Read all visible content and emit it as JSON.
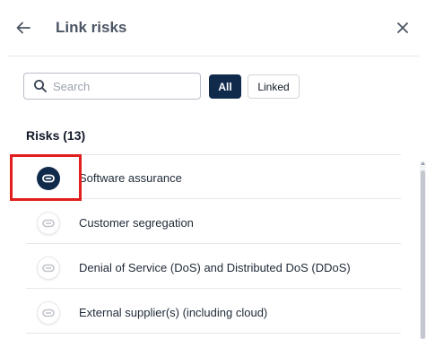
{
  "header": {
    "title": "Link risks",
    "back_icon": "arrow-left-icon",
    "close_icon": "close-icon"
  },
  "search": {
    "placeholder": "Search",
    "value": ""
  },
  "filters": {
    "all_label": "All",
    "linked_label": "Linked",
    "active": "All"
  },
  "section": {
    "heading": "Risks (13)"
  },
  "risks": [
    {
      "label": "Software assurance",
      "linked": true
    },
    {
      "label": "Customer segregation",
      "linked": false
    },
    {
      "label": "Denial of Service (DoS) and Distributed DoS (DDoS)",
      "linked": false
    },
    {
      "label": "External supplier(s) (including cloud)",
      "linked": false
    }
  ],
  "colors": {
    "primary": "#102a4c",
    "highlight": "#e11d1d",
    "divider": "#e5e7eb"
  }
}
